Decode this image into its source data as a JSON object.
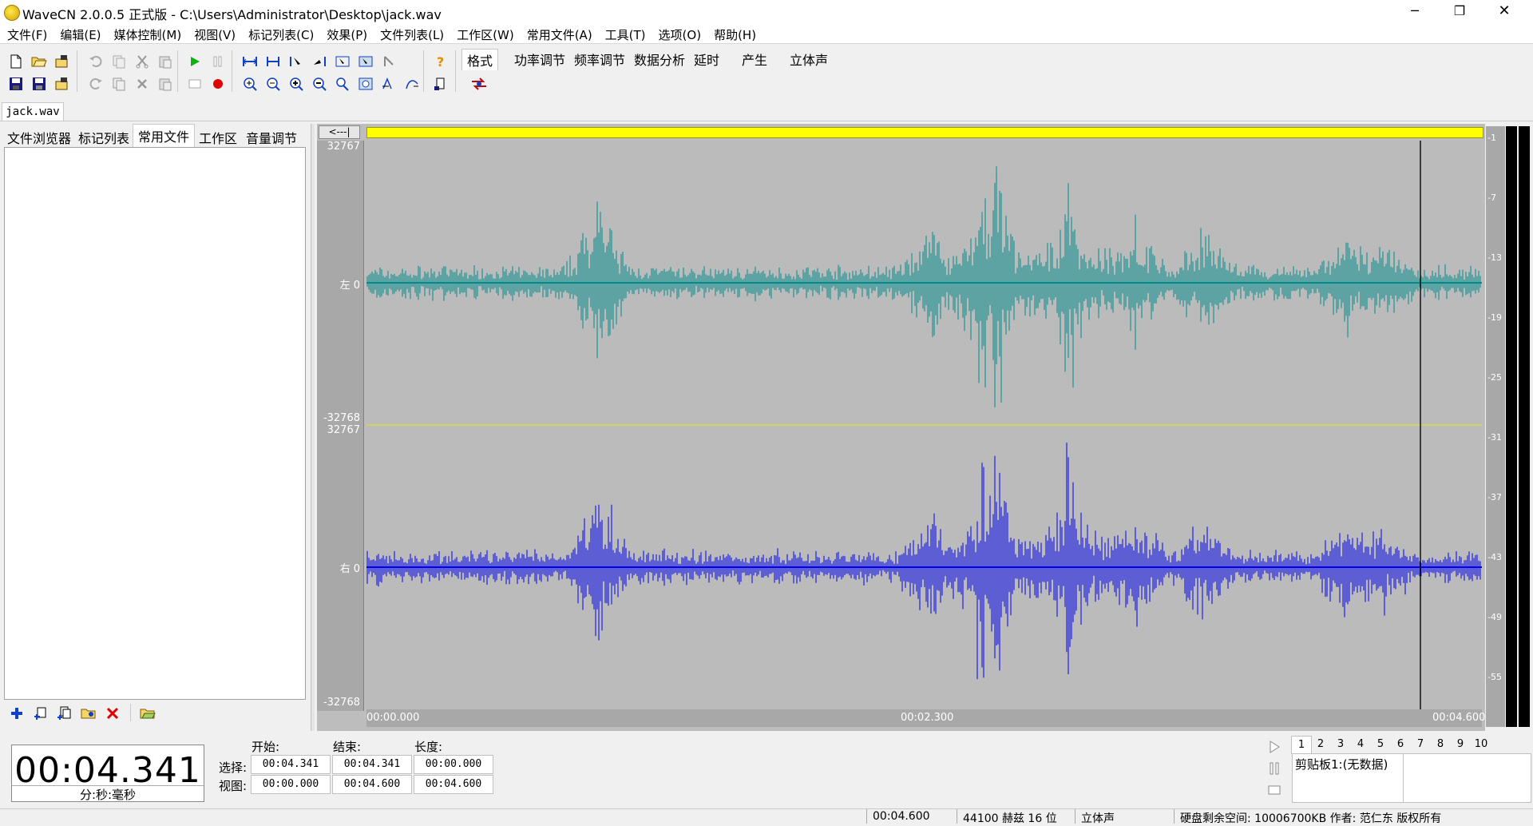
{
  "window": {
    "title": "WaveCN 2.0.0.5 正式版 - C:\\Users\\Administrator\\Desktop\\jack.wav",
    "minimize": "─",
    "restore": "❐",
    "close": "✕"
  },
  "menu": [
    "文件(F)",
    "编辑(E)",
    "媒体控制(M)",
    "视图(V)",
    "标记列表(C)",
    "效果(P)",
    "文件列表(L)",
    "工作区(W)",
    "常用文件(A)",
    "工具(T)",
    "选项(O)",
    "帮助(H)"
  ],
  "func_tabs": [
    "格式",
    "功率调节",
    "频率调节",
    "数据分析",
    "延时",
    "产生",
    "立体声"
  ],
  "doc_tab": "jack.wav",
  "left_tabs": [
    "文件浏览器",
    "标记列表",
    "常用文件",
    "工作区",
    "音量调节"
  ],
  "waveform": {
    "back_button": "<---|",
    "left_channel": {
      "label": "左 0",
      "max": "32767",
      "min": "-32768",
      "color": "#008b8b"
    },
    "right_channel": {
      "label": "右 0",
      "max": "32767",
      "min": "-32768",
      "color": "#0000ee"
    },
    "time_axis": [
      "00:00.000",
      "00:02.300",
      "00:04.600"
    ],
    "meter_labels": [
      "-1",
      "-7",
      "-13",
      "-19",
      "-25",
      "-31",
      "-37",
      "-43",
      "-49",
      "-55"
    ]
  },
  "time_display": {
    "value": "00:04.341",
    "unit": "分:秒:毫秒"
  },
  "selection": {
    "col_start": "开始:",
    "col_end": "结束:",
    "col_length": "长度:",
    "row_select": "选择:",
    "row_view": "视图:",
    "select": {
      "start": "00:04.341",
      "end": "00:04.341",
      "length": "00:00.000"
    },
    "view": {
      "start": "00:00.000",
      "end": "00:04.600",
      "length": "00:04.600"
    }
  },
  "clipboard": {
    "tabs": [
      "1",
      "2",
      "3",
      "4",
      "5",
      "6",
      "7",
      "8",
      "9",
      "10"
    ],
    "label": "剪贴板1:(无数据)"
  },
  "status": {
    "duration": "00:04.600",
    "format": "44100 赫兹  16 位",
    "channels": "立体声",
    "disk": "硬盘剩余空间: 10006700KB 作者: 范仁东 版权所有"
  }
}
